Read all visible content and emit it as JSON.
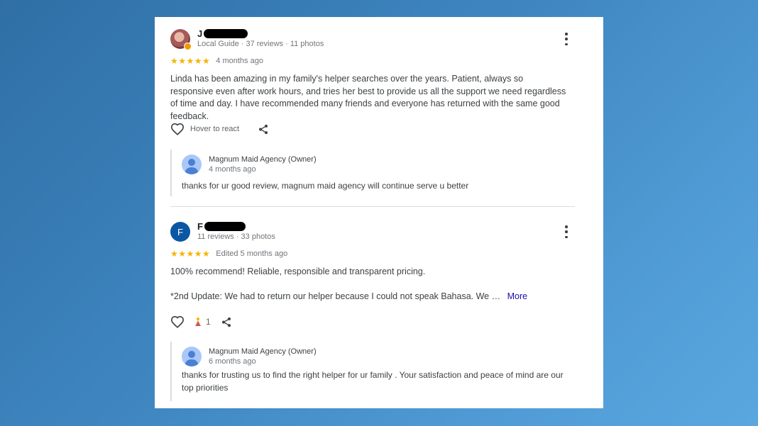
{
  "reviews": [
    {
      "avatar": "profile-photo",
      "name_initial": "J",
      "meta": "Local Guide · 37 reviews · 11 photos",
      "stars": "★★★★★",
      "rating": 5,
      "time": "4 months ago",
      "text": "Linda has been amazing in my family's helper searches over the years. Patient, always so responsive even after work hours, and tries her best to provide us all the support we need regardless of time and day. I have recommended many friends and everyone has returned with the same good feedback.",
      "react_label": "Hover to react",
      "reply": {
        "owner": "Magnum Maid Agency (Owner)",
        "time": "4 months ago",
        "text": "thanks for ur good review, magnum maid agency will continue serve u better"
      }
    },
    {
      "avatar_letter": "F",
      "name_initial": "F",
      "meta": "11 reviews · 33 photos",
      "stars": "★★★★★",
      "rating": 5,
      "time": "Edited 5 months ago",
      "text": "100% recommend! Reliable, responsible and transparent pricing.",
      "text2": "*2nd Update: We had to return our helper because I could not speak Bahasa. We …",
      "more_label": "More",
      "reaction_count": "1",
      "reply": {
        "owner": "Magnum Maid Agency (Owner)",
        "time": "6 months ago",
        "text": "thanks for trusting us to find the right helper for ur family . Your satisfaction and peace of mind are our top priorities"
      }
    }
  ],
  "icons": {
    "more": "more-vert-icon",
    "like": "heart-outline-icon",
    "share": "share-icon",
    "reaction": "celebrate-reaction-icon",
    "owner_avatar": "person-avatar-icon"
  },
  "colors": {
    "star": "#f4b400",
    "more_link": "#1a0dab",
    "avatar_letter_bg": "#0b57a4",
    "owner_avatar_bg": "#a8c7fa"
  }
}
